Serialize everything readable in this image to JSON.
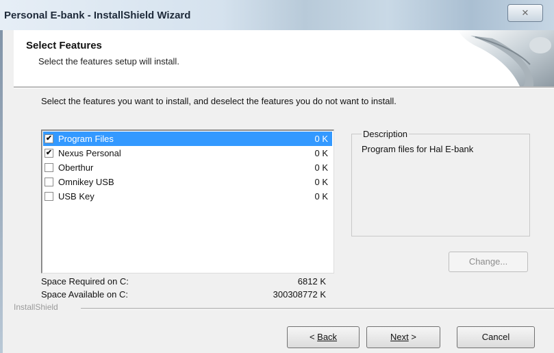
{
  "window": {
    "title": "Personal E-bank - InstallShield Wizard",
    "close_glyph": "✕"
  },
  "header": {
    "title": "Select Features",
    "subtitle": "Select the features setup will install."
  },
  "instruction": "Select the features you want to install, and deselect the features you do not want to install.",
  "features": [
    {
      "label": "Program Files",
      "size": "0 K",
      "checked": true,
      "selected": true
    },
    {
      "label": "Nexus Personal",
      "size": "0 K",
      "checked": true,
      "selected": false
    },
    {
      "label": "Oberthur",
      "size": "0 K",
      "checked": false,
      "selected": false
    },
    {
      "label": "Omnikey USB",
      "size": "0 K",
      "checked": false,
      "selected": false
    },
    {
      "label": "USB Key",
      "size": "0 K",
      "checked": false,
      "selected": false
    }
  ],
  "description": {
    "title": "Description",
    "text": "Program files for Hal E-bank"
  },
  "change_label": "Change...",
  "space": {
    "required_label": "Space Required on  C:",
    "required_value": "6812 K",
    "available_label": "Space Available on  C:",
    "available_value": "300308772 K"
  },
  "brand": "InstallShield",
  "buttons": {
    "back": "Back",
    "next": "Next",
    "cancel": "Cancel"
  },
  "colors": {
    "selection": "#3399ff",
    "title_text": "#1e2a3a"
  }
}
